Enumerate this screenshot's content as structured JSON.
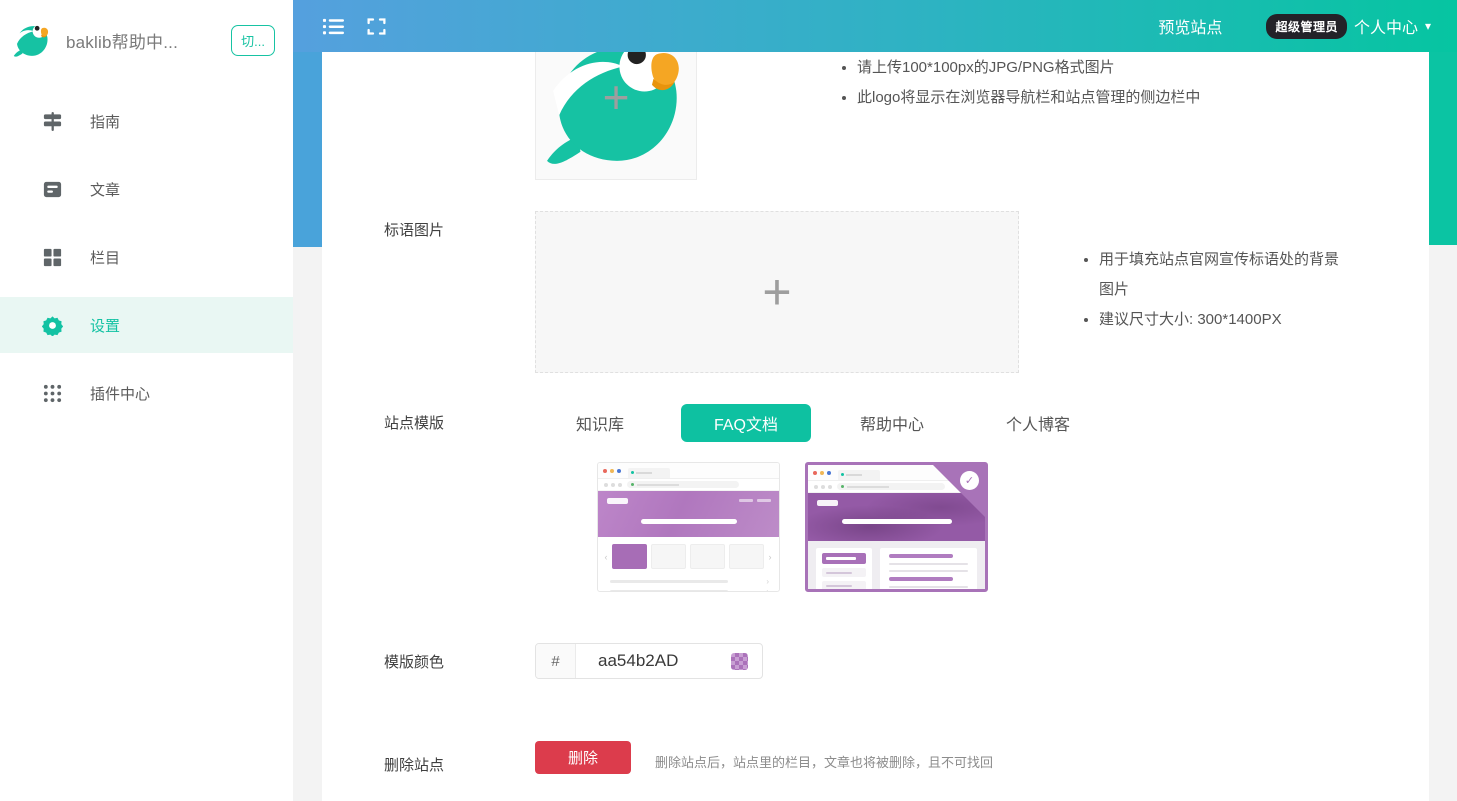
{
  "colors": {
    "topbar_blue": "#55a0de",
    "topbar_teal": "#06c5a1",
    "accent_teal": "#13c2a3",
    "active_item_bg": "#e9f7f3",
    "danger_red": "#dc3c4c",
    "template_purple": "#aa54b2"
  },
  "icons": {
    "caret_down": "▾",
    "plus": "+",
    "check": "✓",
    "chevron_right": "›",
    "arrow_left": "‹",
    "arrow_right": "›"
  },
  "sidebar": {
    "title": "baklib帮助中...",
    "switch_button": "切...",
    "items": [
      {
        "label": "指南",
        "icon": "signpost-icon",
        "active": false
      },
      {
        "label": "文章",
        "icon": "article-icon",
        "active": false
      },
      {
        "label": "栏目",
        "icon": "grid-icon",
        "active": false
      },
      {
        "label": "设置",
        "icon": "gear-icon",
        "active": true
      },
      {
        "label": "插件中心",
        "icon": "dots-grid-icon",
        "active": false
      }
    ]
  },
  "topbar": {
    "preview_label": "预览站点",
    "role_badge": "超级管理员",
    "account_label": "个人中心"
  },
  "form": {
    "logo": {
      "hints": [
        "请上传100*100px的JPG/PNG格式图片",
        "此logo将显示在浏览器导航栏和站点管理的侧边栏中"
      ]
    },
    "banner": {
      "label": "标语图片",
      "hints": [
        "用于填充站点官网宣传标语处的背景图片",
        "建议尺寸大小: 300*1400PX"
      ]
    },
    "template": {
      "label": "站点模版",
      "tabs": [
        {
          "label": "知识库",
          "active": false
        },
        {
          "label": "FAQ文档",
          "active": true
        },
        {
          "label": "帮助中心",
          "active": false
        },
        {
          "label": "个人博客",
          "active": false
        }
      ],
      "previews": [
        {
          "name": "知识库模版预览",
          "selected": false
        },
        {
          "name": "FAQ文档模版预览",
          "selected": true
        }
      ]
    },
    "color": {
      "label": "模版颜色",
      "prefix": "#",
      "value": "aa54b2AD",
      "swatch_color": "#aa54b2"
    },
    "delete": {
      "label": "删除站点",
      "button": "删除",
      "hint": "删除站点后，站点里的栏目，文章也将被删除，且不可找回"
    }
  }
}
